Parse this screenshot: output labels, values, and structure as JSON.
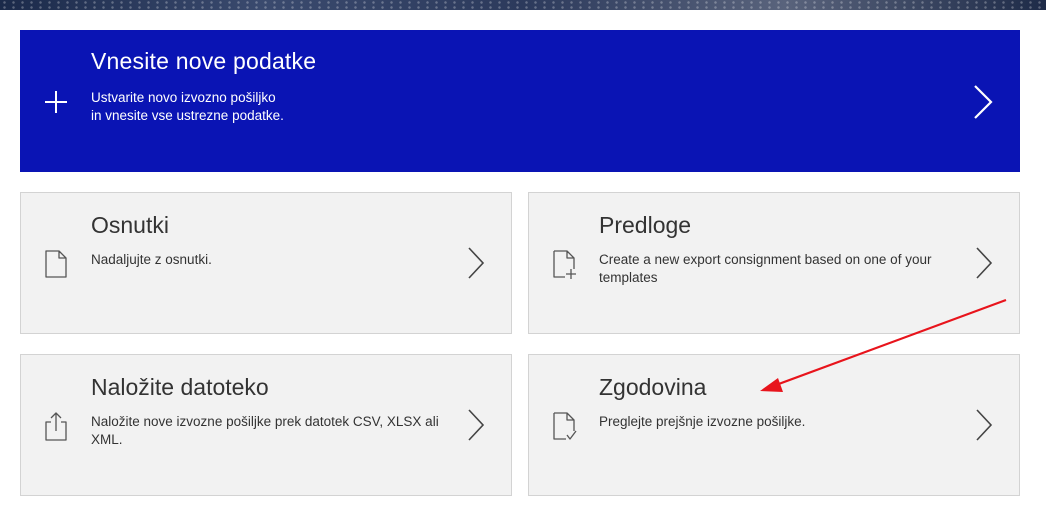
{
  "hero": {
    "title": "Vnesite nove podatke",
    "desc_line1": "Ustvarite novo izvozno pošiljko",
    "desc_line2": "in vnesite vse ustrezne podatke.",
    "background_color": "#0a14b4"
  },
  "cards": {
    "drafts": {
      "title": "Osnutki",
      "desc": "Nadaljujte z osnutki.",
      "icon": "document-icon"
    },
    "templates": {
      "title": "Predloge",
      "desc": "Create a new export consignment based on one of your templates",
      "icon": "document-plus-icon"
    },
    "upload": {
      "title": "Naložite datoteko",
      "desc": "Naložite nove izvozne pošiljke prek datotek CSV, XLSX ali XML.",
      "icon": "upload-icon"
    },
    "history": {
      "title": "Zgodovina",
      "desc": "Preglejte prejšnje izvozne pošiljke.",
      "icon": "document-check-icon"
    }
  },
  "annotation": {
    "color": "#e8141c"
  }
}
